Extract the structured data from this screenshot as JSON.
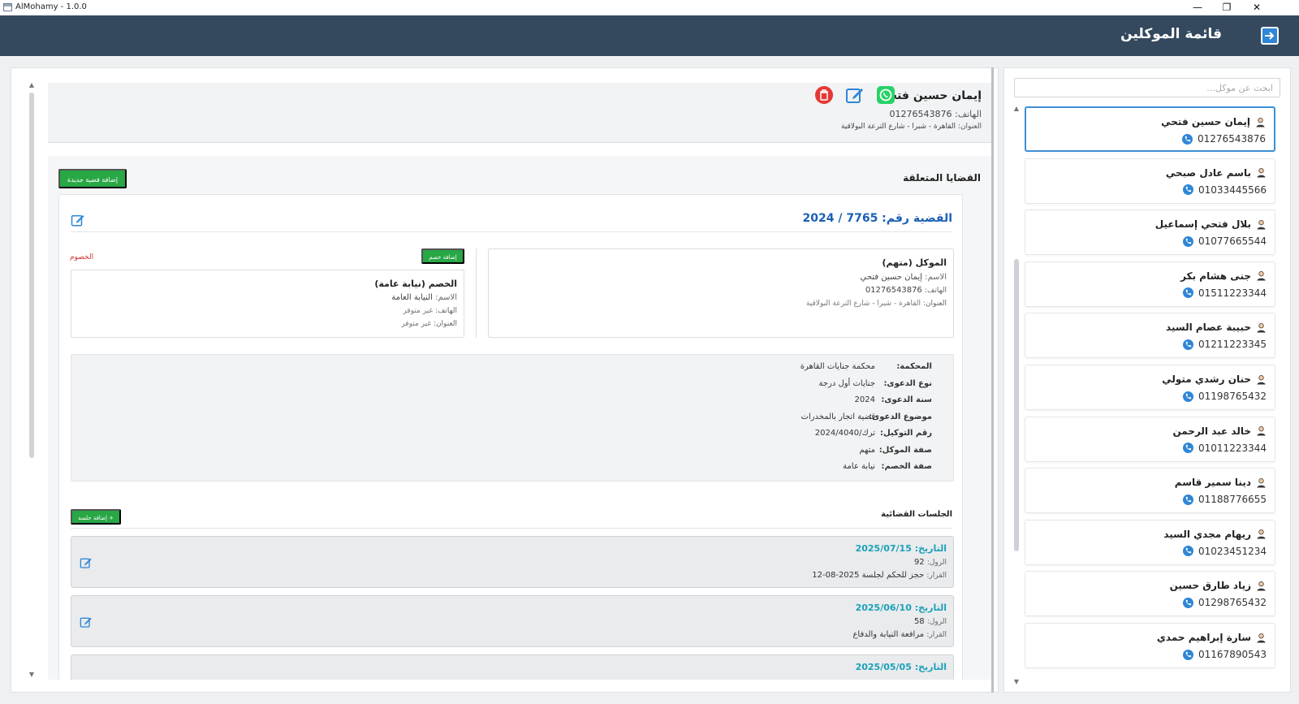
{
  "window": {
    "title": "AlMohamy - 1.0.0",
    "min": "—",
    "restore": "❐",
    "close": "✕"
  },
  "header": {
    "title": "قائمة الموكلين"
  },
  "sidebar": {
    "search_placeholder": "ابحث عن موكل...",
    "clients": [
      {
        "name": "إيمان حسين فتحي",
        "phone": "01276543876"
      },
      {
        "name": "باسم عادل صبحي",
        "phone": "01033445566"
      },
      {
        "name": "بلال فتحي إسماعيل",
        "phone": "01077665544"
      },
      {
        "name": "جنى هشام بكر",
        "phone": "01511223344"
      },
      {
        "name": "حبيبة عصام السيد",
        "phone": "01211223345"
      },
      {
        "name": "حنان رشدي متولي",
        "phone": "01198765432"
      },
      {
        "name": "خالد عبد الرحمن",
        "phone": "01011223344"
      },
      {
        "name": "دينا سمير قاسم",
        "phone": "01188776655"
      },
      {
        "name": "ريهام مجدي السيد",
        "phone": "01023451234"
      },
      {
        "name": "زياد طارق حسين",
        "phone": "01298765432"
      },
      {
        "name": "سارة إبراهيم حمدي",
        "phone": "01167890543"
      }
    ]
  },
  "client": {
    "name": "إيمان حسين فتحي",
    "phone_label": "الهاتف:",
    "phone": "01276543876",
    "address_label": "العنوان:",
    "address": "القاهرة - شبرا - شارع الترعة البولاقية"
  },
  "cases": {
    "title": "القضايا المتعلقة",
    "add_case": "إضافة قضية جديدة",
    "case": {
      "title": "القضية رقم: 7765 / 2024",
      "client_box": {
        "title": "الموكل (متهم)",
        "name_label": "الاسم:",
        "name": "إيمان حسين فتحي",
        "phone_label": "الهاتف:",
        "phone": "01276543876",
        "address_label": "العنوان:",
        "address": "القاهرة - شبرا - شارع الترعة البولاقية"
      },
      "opponents_label": "الخصوم",
      "add_opponent": "إضافة خصم",
      "opponent_box": {
        "title": "الخصم (نيابة عامة)",
        "name_label": "الاسم:",
        "name": "النيابة العامة",
        "phone_label": "الهاتف:",
        "phone": "غير متوفر",
        "address_label": "العنوان:",
        "address": "غير متوفر"
      },
      "details": [
        {
          "k": "المحكمة:",
          "v": "محكمة جنايات القاهرة"
        },
        {
          "k": "نوع الدعوى:",
          "v": "جنايات أول درجة"
        },
        {
          "k": "سنة الدعوى:",
          "v": "2024"
        },
        {
          "k": "موضوع الدعوى:",
          "v": "قضية اتجار بالمخدرات"
        },
        {
          "k": "رقم التوكيل:",
          "v": "ترك/2024/4040"
        },
        {
          "k": "صفة الموكل:",
          "v": "متهم"
        },
        {
          "k": "صفة الخصم:",
          "v": "نيابة عامة"
        }
      ],
      "sessions_title": "الجلسات القضائية",
      "add_session": "+ إضافة جلسة",
      "sessions": [
        {
          "date_label": "التاريخ:",
          "date": "2025/07/15",
          "roll_label": "الرول:",
          "roll": "92",
          "decision_label": "القرار:",
          "decision": "حجز للحكم لجلسة 2025-08-12"
        },
        {
          "date_label": "التاريخ:",
          "date": "2025/06/10",
          "roll_label": "الرول:",
          "roll": "58",
          "decision_label": "القرار:",
          "decision": "مرافعة النيابة والدفاع"
        },
        {
          "date_label": "التاريخ:",
          "date": "2025/05/05",
          "roll_label": "",
          "roll": "",
          "decision_label": "",
          "decision": ""
        }
      ]
    }
  },
  "colors": {
    "header": "#34495e",
    "accent": "#2f86d6",
    "green": "#28a745",
    "case_title": "#1a5fb4",
    "session_date": "#1aa0b8",
    "danger": "#e53935"
  }
}
